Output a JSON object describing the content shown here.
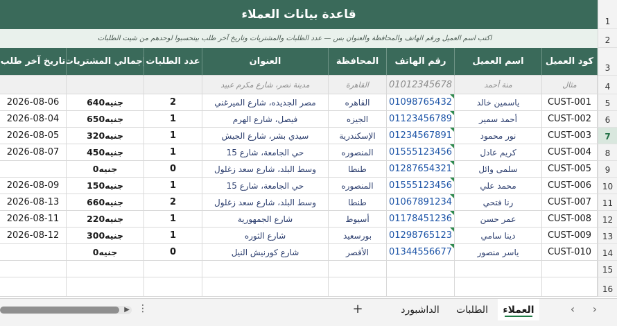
{
  "sheet": {
    "title": "قاعدة بيانات العملاء",
    "note": "اكتب اسم العميل ورقم الهاتف والمحافظة والعنوان بس — عدد الطلبات والمشتريات وتاريخ آخر طلب بيتحسبوا لوحدهم من شيت الطلبات",
    "row_numbers": [
      "1",
      "2",
      "3",
      "4",
      "5",
      "6",
      "7",
      "8",
      "9",
      "10",
      "11",
      "12",
      "13",
      "14",
      "15",
      "16"
    ],
    "headers": {
      "code": "كود العميل",
      "name": "اسم العميل",
      "phone": "رقم الهاتف",
      "gov": "المحافظة",
      "address": "العنوان",
      "orders": "عدد الطلبات",
      "total": "إجمالي المشتريات",
      "last": "تاريخ آخر طلب"
    },
    "example": {
      "code": "مثال",
      "name": "منة أحمد",
      "phone": "01012345678",
      "gov": "القاهرة",
      "address": "مدينة نصر، شارع مكرم عبيد"
    },
    "currency": "جنيه",
    "rows": [
      {
        "code": "CUST-001",
        "name": "ياسمين خالد",
        "phone": "01098765432",
        "gov": "القاهره",
        "address": "مصر الجديده، شارع الميرغني",
        "orders": "2",
        "total": "640",
        "last": "2026-08-06"
      },
      {
        "code": "CUST-002",
        "name": "أحمد سمير",
        "phone": "01123456789",
        "gov": "الجيزه",
        "address": "فيصل، شارع الهرم",
        "orders": "1",
        "total": "650",
        "last": "2026-08-04"
      },
      {
        "code": "CUST-003",
        "name": "نور محمود",
        "phone": "01234567891",
        "gov": "الإسكندرية",
        "address": "سيدي بشر، شارع الجيش",
        "orders": "1",
        "total": "320",
        "last": "2026-08-05"
      },
      {
        "code": "CUST-004",
        "name": "كريم عادل",
        "phone": "01555123456",
        "gov": "المنصوره",
        "address": "حي الجامعة، شارع 15",
        "orders": "1",
        "total": "450",
        "last": "2026-08-07"
      },
      {
        "code": "CUST-005",
        "name": "سلمى وائل",
        "phone": "01287654321",
        "gov": "طنطا",
        "address": "وسط البلد، شارع سعد زغلول",
        "orders": "0",
        "total": "0",
        "last": ""
      },
      {
        "code": "CUST-006",
        "name": "محمد علي",
        "phone": "01555123456",
        "gov": "المنصوره",
        "address": "حي الجامعة، شارع 15",
        "orders": "1",
        "total": "150",
        "last": "2026-08-09"
      },
      {
        "code": "CUST-007",
        "name": "رنا فتحي",
        "phone": "01067891234",
        "gov": "طنطا",
        "address": "وسط البلد، شارع سعد زغلول",
        "orders": "2",
        "total": "660",
        "last": "2026-08-13"
      },
      {
        "code": "CUST-008",
        "name": "عمر حسن",
        "phone": "01178451236",
        "gov": "أسيوط",
        "address": "شارع الجمهورية",
        "orders": "1",
        "total": "220",
        "last": "2026-08-11"
      },
      {
        "code": "CUST-009",
        "name": "دينا سامي",
        "phone": "01298765123",
        "gov": "بورسعيد",
        "address": "شارع الثوره",
        "orders": "1",
        "total": "300",
        "last": "2026-08-12"
      },
      {
        "code": "CUST-010",
        "name": "ياسر منصور",
        "phone": "01344556677",
        "gov": "الأقصر",
        "address": "شارع كورنيش النيل",
        "orders": "0",
        "total": "0",
        "last": ""
      }
    ]
  },
  "tabs": [
    {
      "label": "العملاء",
      "active": true
    },
    {
      "label": "الطلبات",
      "active": false
    },
    {
      "label": "الداشبورد",
      "active": false
    }
  ],
  "tabbar": {
    "add_label": "+",
    "more_label": "⋮",
    "prev_label": "‹",
    "next_label": "›"
  },
  "colors": {
    "header_bg": "#3a6a5a",
    "note_bg": "#e9f1ec",
    "phone_text": "#1f56a8",
    "active_tab_underline": "#1e7a45"
  }
}
